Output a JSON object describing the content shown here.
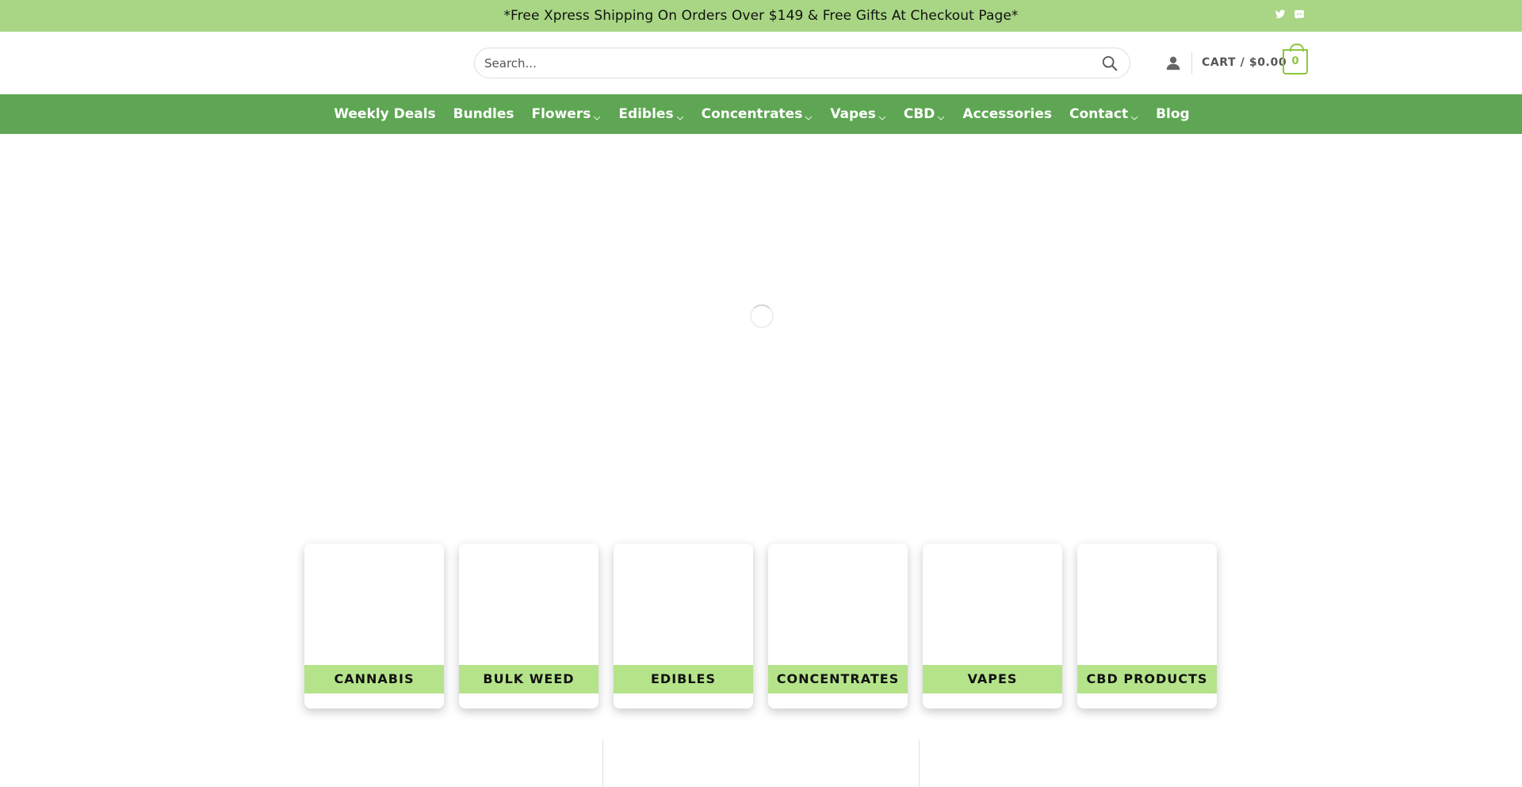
{
  "topbar": {
    "announcement": "*Free Xpress Shipping On Orders Over $149 & Free Gifts At Checkout Page*",
    "social_icons": [
      "twitter-icon",
      "discord-icon"
    ]
  },
  "header": {
    "search": {
      "placeholder": "Search..."
    },
    "cart": {
      "label": "CART / $0.00",
      "count": "0"
    }
  },
  "nav": {
    "items": [
      {
        "label": "Weekly Deals",
        "dropdown": false
      },
      {
        "label": "Bundles",
        "dropdown": false
      },
      {
        "label": "Flowers",
        "dropdown": true
      },
      {
        "label": "Edibles",
        "dropdown": true
      },
      {
        "label": "Concentrates",
        "dropdown": true
      },
      {
        "label": "Vapes",
        "dropdown": true
      },
      {
        "label": "CBD",
        "dropdown": true
      },
      {
        "label": "Accessories",
        "dropdown": false
      },
      {
        "label": "Contact",
        "dropdown": true
      },
      {
        "label": "Blog",
        "dropdown": false
      }
    ]
  },
  "categories": [
    {
      "label": "CANNABIS"
    },
    {
      "label": "BULK WEED"
    },
    {
      "label": "EDIBLES"
    },
    {
      "label": "CONCENTRATES"
    },
    {
      "label": "VAPES"
    },
    {
      "label": "CBD PRODUCTS"
    }
  ],
  "colors": {
    "topbar": "#a8d685",
    "nav": "#5ea653",
    "accent": "#8dc63f",
    "category_label": "#b5e38a"
  }
}
